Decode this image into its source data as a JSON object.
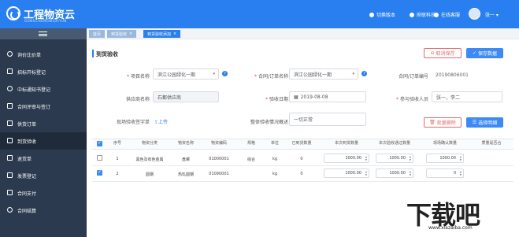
{
  "app": {
    "title": "工程物资云",
    "subtitle": "GONGCHENGWUZIYUN"
  },
  "topbar": {
    "actions": [
      "切换版本",
      "府联科技",
      "在线客服"
    ],
    "user": "张一"
  },
  "sidebar": {
    "items": [
      {
        "label": "询价比价单",
        "icon": "clock-icon"
      },
      {
        "label": "招标开标登记",
        "icon": "document-icon"
      },
      {
        "label": "中标通知书登记",
        "icon": "gear-icon"
      },
      {
        "label": "合同评审与签订",
        "icon": "document-icon"
      },
      {
        "label": "供货订单",
        "icon": "cart-icon"
      },
      {
        "label": "到货验收",
        "icon": "list-icon"
      },
      {
        "label": "退货单",
        "icon": "calendar-icon"
      },
      {
        "label": "发票登记",
        "icon": "receipt-icon"
      },
      {
        "label": "合同支付",
        "icon": "wallet-icon"
      },
      {
        "label": "合同结算",
        "icon": "settle-icon"
      }
    ]
  },
  "tabs": [
    {
      "label": "首页"
    },
    {
      "label": "到货验收"
    },
    {
      "label": "到货验收添加"
    }
  ],
  "panel": {
    "title": "到货验收",
    "cancel_label": "取消保存",
    "save_label": "保存数据"
  },
  "form": {
    "project_label": "项目名称",
    "project_value": "滨江公园绿化一期",
    "contract_label": "合同/订单名称",
    "contract_value": "滨江公园绿化一期",
    "contract_no_label": "合同/订单编号",
    "contract_no_value": "20190806001",
    "supplier_label": "供应商名称",
    "supplier_value": "石都供应商",
    "date_label": "验收日期",
    "date_value": "2019-08-08",
    "participants_label": "参与验收人员",
    "participants_value": "张一，李二",
    "photo_label": "现场验收签字单",
    "upload_label": "上传",
    "overall_label": "整体验收情况概述",
    "overall_value": "一切正常",
    "batch_delete_label": "批量删除",
    "select_detail_label": "选择明细"
  },
  "table": {
    "headers": [
      "序号",
      "物资分类",
      "物资名称",
      "物资编码",
      "规格",
      "单位",
      "已到货数量",
      "本次到货数量",
      "本次验收通过数量",
      "现场确认数量",
      "质量是否合"
    ],
    "rows": [
      {
        "index": "1",
        "category": "黑色及有色金属",
        "name": "盘螺",
        "code": "01000001",
        "spec": "综合",
        "unit": "kg",
        "arrived": "0",
        "this_arrival": "1000.00",
        "accepted": "1000.00",
        "confirmed": "1000.00",
        "checked": false
      },
      {
        "index": "2",
        "category": "圆钢",
        "name": "热轧圆钢",
        "code": "01090001",
        "spec": "",
        "unit": "kg",
        "arrived": "0",
        "this_arrival": "1000.00",
        "accepted": "1000.00",
        "confirmed": "0",
        "checked": true
      }
    ]
  },
  "watermark": {
    "text": "下载吧",
    "url": "www.xiazaiba.com"
  },
  "colors": {
    "primary": "#2a7ff0",
    "sidebar": "#2b3a4e",
    "danger": "#e56b6b"
  }
}
